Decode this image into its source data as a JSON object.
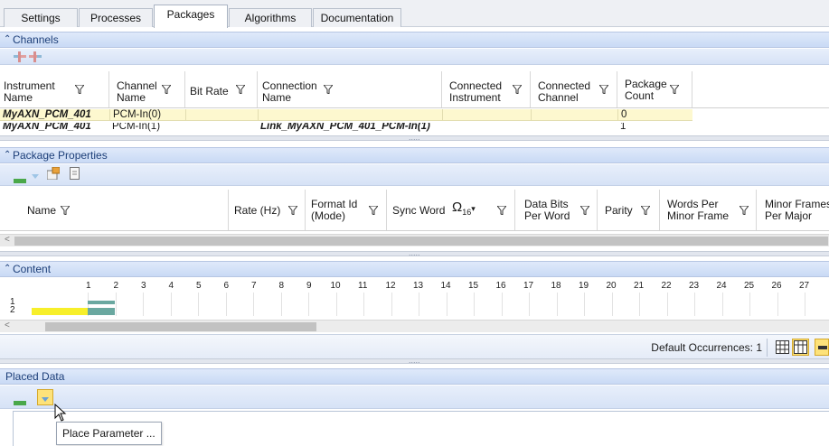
{
  "tabs": [
    {
      "label": "Settings"
    },
    {
      "label": "Processes"
    },
    {
      "label": "Packages"
    },
    {
      "label": "Algorithms"
    },
    {
      "label": "Documentation"
    }
  ],
  "active_tab": "Packages",
  "channels": {
    "title": "Channels",
    "columns": [
      {
        "line1": "Instrument",
        "line2": "Name"
      },
      {
        "line1": "Channel",
        "line2": "Name"
      },
      {
        "line1": "Bit Rate",
        "line2": ""
      },
      {
        "line1": "Connection",
        "line2": "Name"
      },
      {
        "line1": "Connected",
        "line2": "Instrument"
      },
      {
        "line1": "Connected",
        "line2": "Channel"
      },
      {
        "line1": "Package",
        "line2": "Count"
      }
    ],
    "rows": [
      {
        "instrument": "MyAXN_PCM_401",
        "channel": "PCM-In(0)",
        "bit_rate": "",
        "connection": "",
        "conn_instrument": "",
        "conn_channel": "",
        "count": "0"
      },
      {
        "instrument": "MyAXN_PCM_401",
        "channel": "PCM-In(1)",
        "bit_rate": "",
        "connection": "Link_MyAXN_PCM_401_PCM-In(1)",
        "conn_instrument": "",
        "conn_channel": "",
        "count": "1"
      }
    ]
  },
  "package_properties": {
    "title": "Package Properties",
    "columns": [
      {
        "line1": "Name",
        "line2": ""
      },
      {
        "line1": "Rate (Hz)",
        "line2": ""
      },
      {
        "line1": "Format Id",
        "line2": "(Mode)"
      },
      {
        "line1": "Sync Word",
        "line2": ""
      },
      {
        "line1": "Data Bits",
        "line2": "Per Word"
      },
      {
        "line1": "Parity",
        "line2": ""
      },
      {
        "line1": "Words Per",
        "line2": "Minor Frame"
      },
      {
        "line1": "Minor Frames",
        "line2": "Per Major"
      }
    ],
    "sync_radix": "Ω",
    "sync_radix_sub": "16"
  },
  "content": {
    "title": "Content",
    "ruler": [
      "1",
      "2",
      "3",
      "4",
      "5",
      "6",
      "7",
      "8",
      "9",
      "10",
      "11",
      "12",
      "13",
      "14",
      "15",
      "16",
      "17",
      "18",
      "19",
      "20",
      "21",
      "22",
      "23",
      "24",
      "25",
      "26",
      "27"
    ],
    "row_labels": [
      "1",
      "2"
    ],
    "default_occurrences": "Default Occurrences: 1",
    "colors": {
      "highlight": "#f7ef2a",
      "teal": "#6aa8a0"
    }
  },
  "placed_data": {
    "title": "Placed Data",
    "tooltip": "Place Parameter ..."
  }
}
